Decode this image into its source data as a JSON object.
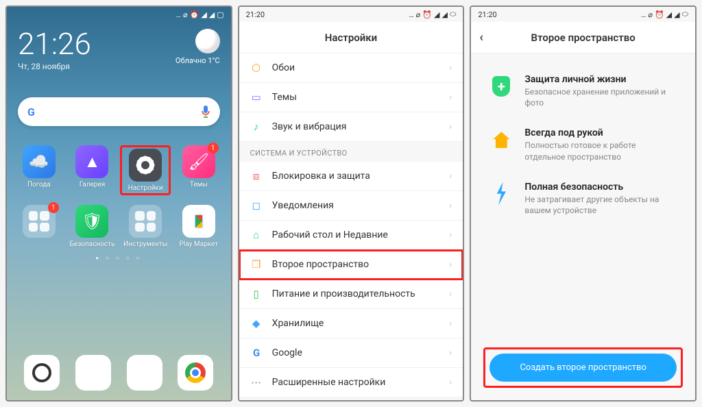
{
  "phone1": {
    "status_time": "",
    "time": "21:26",
    "date": "Чт, 28 ноября",
    "weather_text": "Облачно",
    "weather_temp": "1°C",
    "apps_row1": [
      {
        "label": "Погода",
        "icon": "weather",
        "badge": null
      },
      {
        "label": "Галерея",
        "icon": "gallery",
        "badge": null
      },
      {
        "label": "Настройки",
        "icon": "settings",
        "badge": null,
        "highlight": true
      },
      {
        "label": "Темы",
        "icon": "themes",
        "badge": "1"
      }
    ],
    "apps_row2": [
      {
        "label": "",
        "icon": "folder",
        "badge": "1"
      },
      {
        "label": "Безопасность",
        "icon": "security",
        "badge": null
      },
      {
        "label": "Инструменты",
        "icon": "tools",
        "badge": null
      },
      {
        "label": "Play Маркет",
        "icon": "play",
        "badge": null
      }
    ],
    "dock": [
      "camera",
      "phone",
      "message",
      "chrome"
    ]
  },
  "phone2": {
    "status_time": "21:20",
    "title": "Настройки",
    "group1": [
      {
        "label": "Обои",
        "icon": "⬡",
        "c": "c-orange"
      },
      {
        "label": "Темы",
        "icon": "▭",
        "c": "c-purple"
      },
      {
        "label": "Звук и вибрация",
        "icon": "◁)",
        "c": "c-teal"
      }
    ],
    "section": "СИСТЕМА И УСТРОЙСТВО",
    "group2": [
      {
        "label": "Блокировка и защита",
        "icon": "🔒",
        "c": "c-red",
        "hl": false
      },
      {
        "label": "Уведомления",
        "icon": "◻",
        "c": "c-blue",
        "hl": false
      },
      {
        "label": "Рабочий стол и Недавние",
        "icon": "⌂",
        "c": "c-teal",
        "hl": false
      },
      {
        "label": "Второе пространство",
        "icon": "❐",
        "c": "c-orange",
        "hl": true
      },
      {
        "label": "Питание и производительность",
        "icon": "▯",
        "c": "c-green",
        "hl": false
      },
      {
        "label": "Хранилище",
        "icon": "◆",
        "c": "c-blue",
        "hl": false
      },
      {
        "label": "Google",
        "icon": "G",
        "c": "c-blue",
        "hl": false
      },
      {
        "label": "Расширенные настройки",
        "icon": "⚙",
        "c": "c-gray",
        "hl": false
      }
    ]
  },
  "phone3": {
    "status_time": "21:20",
    "title": "Второе пространство",
    "items": [
      {
        "title": "Защита личной жизни",
        "sub": "Безопасное хранение приложений и фото"
      },
      {
        "title": "Всегда под рукой",
        "sub": "Полностью готовое к работе отдельное пространство"
      },
      {
        "title": "Полная безопасность",
        "sub": "Не затрагивает другие объекты на вашем устройстве"
      }
    ],
    "cta": "Создать второе пространство"
  },
  "status_icons": "…⌀ ⏰ 📶 📶 🔋"
}
